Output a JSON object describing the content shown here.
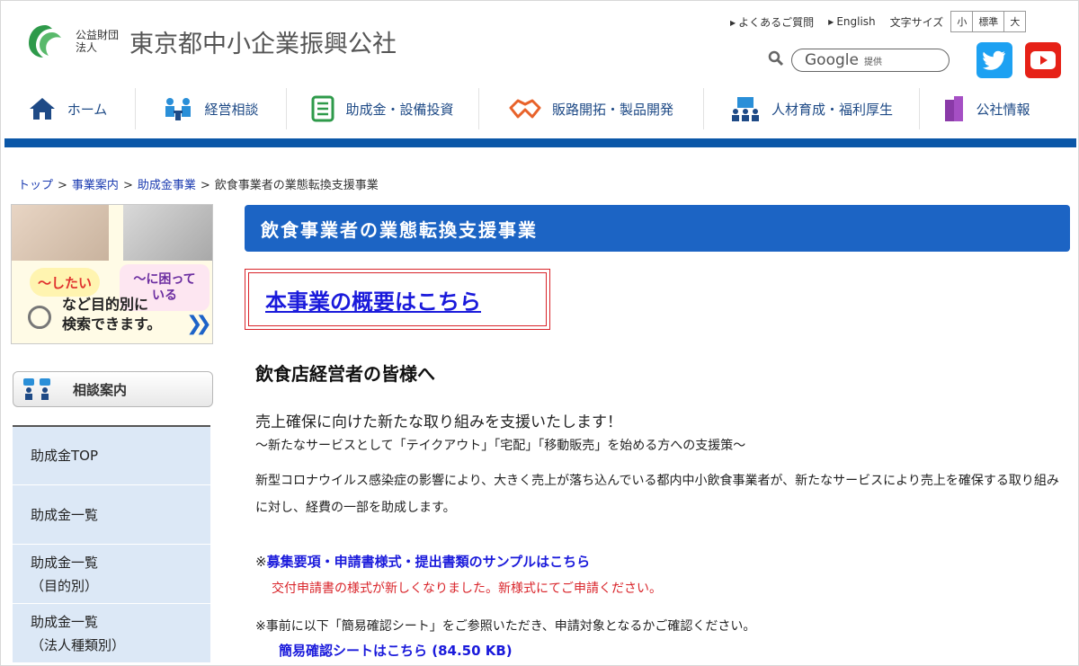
{
  "header": {
    "org_type": "公益財団法人",
    "org_name": "東京都中小企業振興公社",
    "links": [
      "よくあるご質問",
      "English"
    ],
    "font_size_label": "文字サイズ",
    "font_sizes": [
      "小",
      "標準",
      "大"
    ],
    "search_brand": "Google",
    "search_suffix": "提供"
  },
  "nav": {
    "items": [
      {
        "label": "ホーム",
        "icon": "house-icon"
      },
      {
        "label": "経営相談",
        "icon": "consultation-icon"
      },
      {
        "label": "助成金・設備投資",
        "icon": "document-list-icon"
      },
      {
        "label": "販路開拓・製品開発",
        "icon": "handshake-icon"
      },
      {
        "label": "人材育成・福利厚生",
        "icon": "training-icon"
      },
      {
        "label": "公社情報",
        "icon": "building-icon"
      }
    ]
  },
  "breadcrumb": {
    "items": [
      "トップ",
      "事業案内",
      "助成金事業"
    ],
    "current": "飲食事業者の業態転換支援事業",
    "separator": ">"
  },
  "sidebar": {
    "banner": {
      "bubble1": "〜したい",
      "bubble2_line1": "〜に困って",
      "bubble2_line2": "いる",
      "text_line1": "など目的別に",
      "text_line2": "検索できます。"
    },
    "consult_label": "相談案内",
    "items": [
      {
        "line1": "助成金TOP",
        "line2": ""
      },
      {
        "line1": "助成金一覧",
        "line2": ""
      },
      {
        "line1": "助成金一覧",
        "line2": "（目的別）"
      },
      {
        "line1": "助成金一覧",
        "line2": "（法人種類別）"
      }
    ]
  },
  "main": {
    "title": "飲食事業者の業態転換支援事業",
    "overview_link": "本事業の概要はこちら",
    "heading": "飲食店経営者の皆様へ",
    "lead": "売上確保に向けた新たな取り組みを支援いたします！",
    "sub": "〜新たなサービスとして「テイクアウト」「宅配」「移動販売」を始める方への支援策〜",
    "body": "新型コロナウイルス感染症の影響により、大きく売上が落ち込んでいる都内中小飲食事業者が、新たなサービスにより売上を確保する取り組みに対し、経費の一部を助成します。",
    "note1_mark": "※",
    "note1_link": "募集要項・申請書様式・提出書類のサンプルはこちら",
    "red_note": "交付申請書の様式が新しくなりました。新様式にてご申請ください。",
    "note2": "※事前に以下「簡易確認シート」をご参照いただき、申請対象となるかご確認ください。",
    "note2_link": "簡易確認シートはこちら (84.50 KB)"
  },
  "colors": {
    "brand_blue": "#0b57a8",
    "title_bar": "#1c64c4",
    "link": "#1a1adb",
    "alert_red": "#d9242a",
    "sidebar_item_bg": "#dce8f6"
  }
}
